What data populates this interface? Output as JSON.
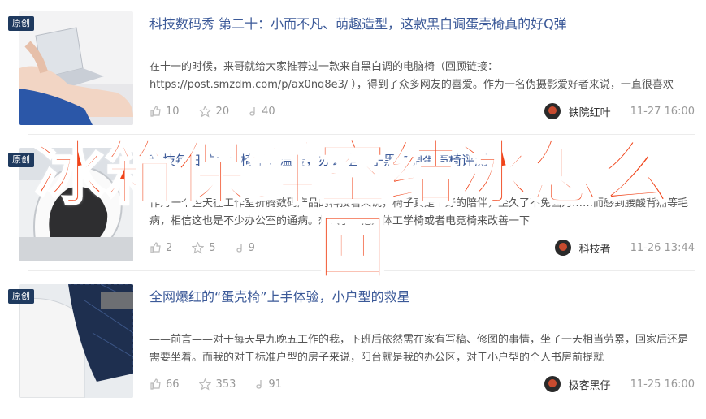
{
  "badge_label": "原创",
  "overlay_title": "冰箱保鲜室结冰怎么回",
  "overlay_title_line2": "回",
  "colors": {
    "accent": "#3b5998",
    "badge": "#1f3a5f",
    "overlay": "#f0441a"
  },
  "articles": [
    {
      "title": "科技数码秀 第二十：小而不凡、萌趣造型，这款黑白调蛋壳椅真的好Q弹",
      "desc": "在十一的时候，来哥就给大家推荐过一款来自黑白调的电脑椅（回顾链接：https://post.smzdm.com/p/ax0nq8e3/ ），得到了众多网友的喜爱。作为一名伪摄影爱好者来说，一直很喜欢",
      "likes": "10",
      "favorites": "20",
      "comments": "40",
      "author": "铁院红叶",
      "time": "11-27 16:00"
    },
    {
      "title": "科技每日推：小椅子大温暖，办公室椅子黑白调蛋壳椅评测",
      "desc": "作为一个整天在工作室折腾数码产品的科技君来说，椅子真是个好的陪伴，坐久了不免因为……而感到腰酸背痛等毛病，相信这也是不少办公室的通病。想入手一把人体工学椅或者电竞椅来改善一下",
      "likes": "2",
      "favorites": "5",
      "comments": "9",
      "author": "科技者",
      "time": "11-26 13:44"
    },
    {
      "title": "全网爆红的“蛋壳椅”上手体验，小户型的救星",
      "desc": "——前言——对于每天早九晚五工作的我，下班后依然需在家有写稿、修图的事情，坐了一天相当劳累，回家后还是需要坐着。而我的对于标准户型的房子来说，阳台就是我的办公区，对于小户型的个人书房前提就",
      "likes": "66",
      "favorites": "353",
      "comments": "91",
      "author": "极客黑仔",
      "time": "11-25 16:00"
    }
  ]
}
